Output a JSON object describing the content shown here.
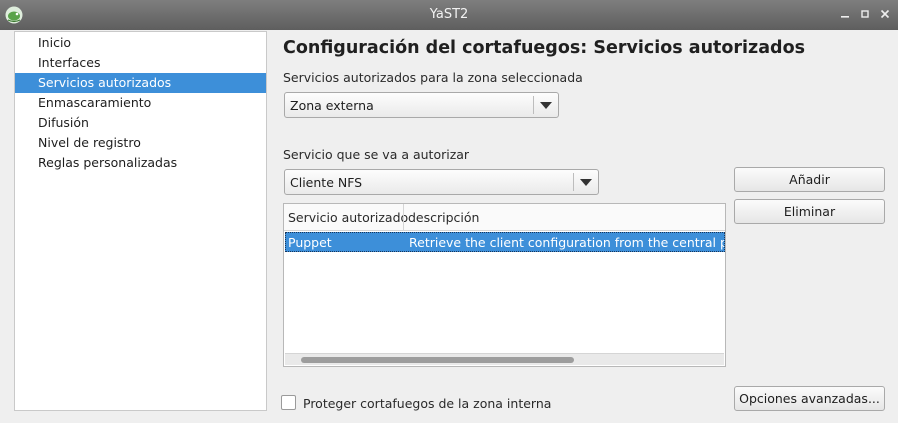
{
  "window": {
    "title": "YaST2",
    "minimize_label": "‗",
    "maximize_label": "▫",
    "close_label": "✕"
  },
  "sidebar": {
    "items": [
      {
        "label": "Inicio",
        "selected": false
      },
      {
        "label": "Interfaces",
        "selected": false
      },
      {
        "label": "Servicios autorizados",
        "selected": true
      },
      {
        "label": "Enmascaramiento",
        "selected": false
      },
      {
        "label": "Difusión",
        "selected": false
      },
      {
        "label": "Nivel de registro",
        "selected": false
      },
      {
        "label": "Reglas personalizadas",
        "selected": false
      }
    ]
  },
  "main": {
    "heading": "Configuración del cortafuegos: Servicios autorizados",
    "zone_label": "Servicios autorizados para la zona seleccionada",
    "zone_value": "Zona externa",
    "service_label": "Servicio que se va a autorizar",
    "service_value": "Cliente NFS",
    "table": {
      "columns": [
        "Servicio autorizado",
        "descripción"
      ],
      "rows": [
        [
          "Puppet",
          "Retrieve the client configuration from the central puppet server"
        ]
      ]
    },
    "add_button": "Añadir",
    "remove_button": "Eliminar",
    "advanced_button": "Opciones avanzadas...",
    "protect_checkbox_label": "Proteger cortafuegos de la zona interna",
    "protect_checked": false
  },
  "colors": {
    "selection": "#3d8fd9",
    "titlebar": "#6e6e6e"
  }
}
